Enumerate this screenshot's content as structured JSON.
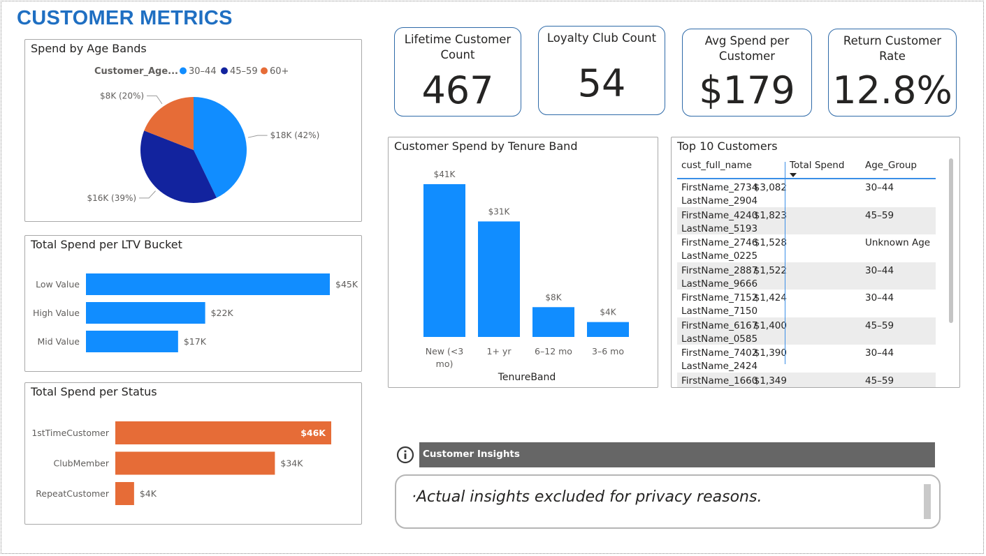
{
  "page": {
    "title": "CUSTOMER METRICS"
  },
  "colors": {
    "blue": "#118dff",
    "navy": "#12239e",
    "orange": "#e66c37",
    "title": "#1f6fc2"
  },
  "kpis": [
    {
      "label": "Lifetime Customer Count",
      "value": "467"
    },
    {
      "label": "Loyalty Club Count",
      "value": "54"
    },
    {
      "label": "Avg Spend per Customer",
      "value": "$179"
    },
    {
      "label": "Return Customer Rate",
      "value": "12.8%"
    }
  ],
  "age_chart": {
    "title": "Spend by Age Bands",
    "legend_title": "Customer_Age...",
    "legend": [
      "30–44",
      "45–59",
      "60+"
    ]
  },
  "ltv_chart": {
    "title": "Total Spend per LTV Bucket"
  },
  "status_chart": {
    "title": "Total Spend per Status"
  },
  "tenure_chart": {
    "title": "Customer Spend by Tenure Band",
    "xlabel": "TenureBand"
  },
  "chart_data": [
    {
      "type": "pie",
      "title": "Spend by Age Bands",
      "legend_title": "Customer_Age...",
      "categories": [
        "30–44",
        "45–59",
        "60+"
      ],
      "values": [
        18,
        16,
        8
      ],
      "labels": [
        "$18K (42%)",
        "$16K (39%)",
        "$8K (20%)"
      ],
      "legend_position": "top"
    },
    {
      "type": "bar",
      "orientation": "horizontal",
      "title": "Total Spend per LTV Bucket",
      "categories": [
        "Low Value",
        "High Value",
        "Mid Value"
      ],
      "values": [
        45,
        22,
        17
      ],
      "labels": [
        "$45K",
        "$22K",
        "$17K"
      ]
    },
    {
      "type": "bar",
      "orientation": "horizontal",
      "title": "Total Spend per Status",
      "categories": [
        "1stTimeCustomer",
        "ClubMember",
        "RepeatCustomer"
      ],
      "values": [
        46,
        34,
        4
      ],
      "labels": [
        "$46K",
        "$34K",
        "$4K"
      ]
    },
    {
      "type": "bar",
      "orientation": "vertical",
      "title": "Customer Spend by Tenure Band",
      "xlabel": "TenureBand",
      "categories": [
        "New (<3 mo)",
        "1+ yr",
        "6–12 mo",
        "3–6 mo"
      ],
      "values": [
        41,
        31,
        8,
        4
      ],
      "labels": [
        "$41K",
        "$31K",
        "$8K",
        "$4K"
      ]
    }
  ],
  "top_customers": {
    "title": "Top 10 Customers",
    "columns": [
      "cust_full_name",
      "Total Spend",
      "Age_Group"
    ],
    "rows": [
      {
        "name1": "FirstName_2734",
        "name2": "LastName_2904",
        "spend": "$3,082",
        "age": "30–44"
      },
      {
        "name1": "FirstName_4240",
        "name2": "LastName_5193",
        "spend": "$1,823",
        "age": "45–59"
      },
      {
        "name1": "FirstName_2746",
        "name2": "LastName_0225",
        "spend": "$1,528",
        "age": "Unknown Age"
      },
      {
        "name1": "FirstName_2887",
        "name2": "LastName_9666",
        "spend": "$1,522",
        "age": "30–44"
      },
      {
        "name1": "FirstName_7152",
        "name2": "LastName_7150",
        "spend": "$1,424",
        "age": "30–44"
      },
      {
        "name1": "FirstName_6167",
        "name2": "LastName_0585",
        "spend": "$1,400",
        "age": "45–59"
      },
      {
        "name1": "FirstName_7402",
        "name2": "LastName_2424",
        "spend": "$1,390",
        "age": "30–44"
      },
      {
        "name1": "FirstName_1660",
        "name2": "",
        "spend": "$1,349",
        "age": "45–59"
      }
    ]
  },
  "insights": {
    "header": "Customer Insights",
    "text": "·Actual insights excluded for privacy reasons."
  }
}
